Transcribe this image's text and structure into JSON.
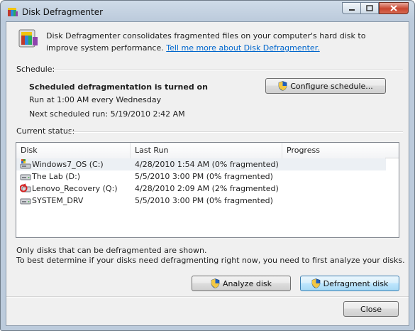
{
  "window": {
    "title": "Disk Defragmenter",
    "icon": "defrag-app-icon",
    "controls": [
      "minimize",
      "maximize",
      "close"
    ]
  },
  "intro": {
    "text": "Disk Defragmenter consolidates fragmented files on your computer's hard disk to improve system performance. ",
    "link": "Tell me more about Disk Defragmenter."
  },
  "schedule": {
    "label": "Schedule:",
    "status": "Scheduled defragmentation is turned on",
    "run_at": "Run at 1:00 AM every Wednesday",
    "next_run": "Next scheduled run: 5/19/2010 2:42 AM",
    "configure_button": "Configure schedule..."
  },
  "current_status": {
    "label": "Current status:",
    "columns": [
      "Disk",
      "Last Run",
      "Progress"
    ],
    "rows": [
      {
        "disk": "Windows7_OS (C:)",
        "last_run": "4/28/2010 1:54 AM (0% fragmented)",
        "progress": "",
        "icon": "system-drive-icon"
      },
      {
        "disk": "The Lab (D:)",
        "last_run": "5/5/2010 3:00 PM (0% fragmented)",
        "progress": "",
        "icon": "hard-drive-icon"
      },
      {
        "disk": "Lenovo_Recovery (Q:)",
        "last_run": "4/28/2010 2:09 AM (2% fragmented)",
        "progress": "",
        "icon": "recovery-drive-icon"
      },
      {
        "disk": "SYSTEM_DRV",
        "last_run": "5/5/2010 3:00 PM (0% fragmented)",
        "progress": "",
        "icon": "hard-drive-icon"
      }
    ]
  },
  "notes": {
    "line1": "Only disks that can be defragmented are shown.",
    "line2": "To best determine if your disks need defragmenting right now, you need to first analyze your disks."
  },
  "actions": {
    "analyze": "Analyze disk",
    "defragment": "Defragment disk",
    "close": "Close"
  }
}
